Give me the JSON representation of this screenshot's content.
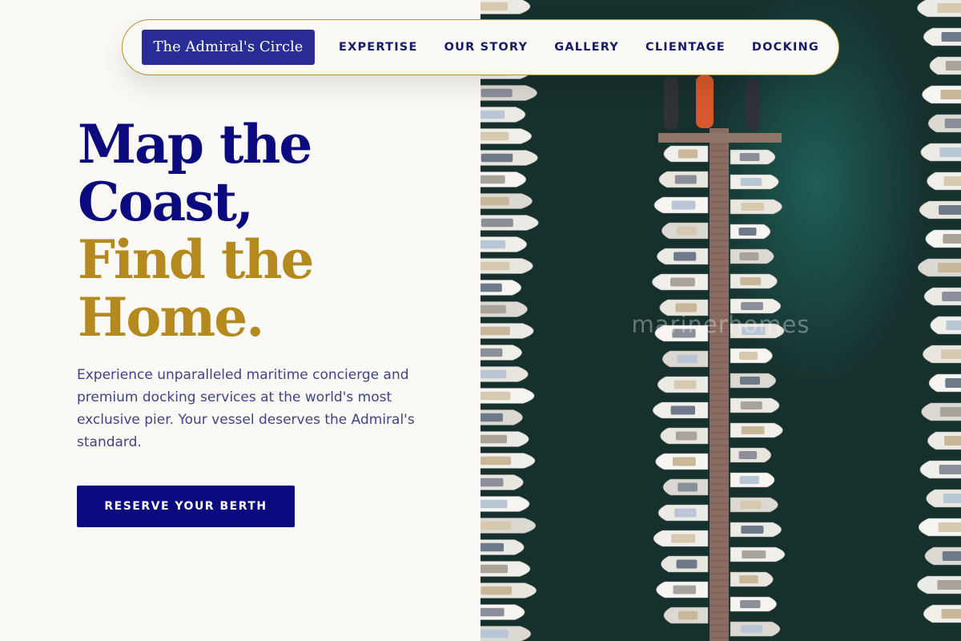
{
  "nav": {
    "brand": "The Admiral's Circle",
    "links": [
      {
        "label": "EXPERTISE"
      },
      {
        "label": "OUR STORY"
      },
      {
        "label": "GALLERY"
      },
      {
        "label": "CLIENTAGE"
      },
      {
        "label": "DOCKING"
      }
    ]
  },
  "hero": {
    "headline_line1": "Map the",
    "headline_line2": "Coast,",
    "headline_line3": "Find the",
    "headline_line4": "Home.",
    "lead": "Experience unparalleled maritime concierge and premium docking services at the world's most exclusive pier. Your vessel deserves the Admiral's standard.",
    "cta_label": "RESERVE YOUR BERTH"
  },
  "photo": {
    "watermark": "marinerhomes"
  },
  "colors": {
    "navy": "#0a0a7e",
    "gold": "#b48a1f",
    "brand_button": "#2a2d96",
    "background": "#fbf9f5",
    "water": "#16302d"
  }
}
